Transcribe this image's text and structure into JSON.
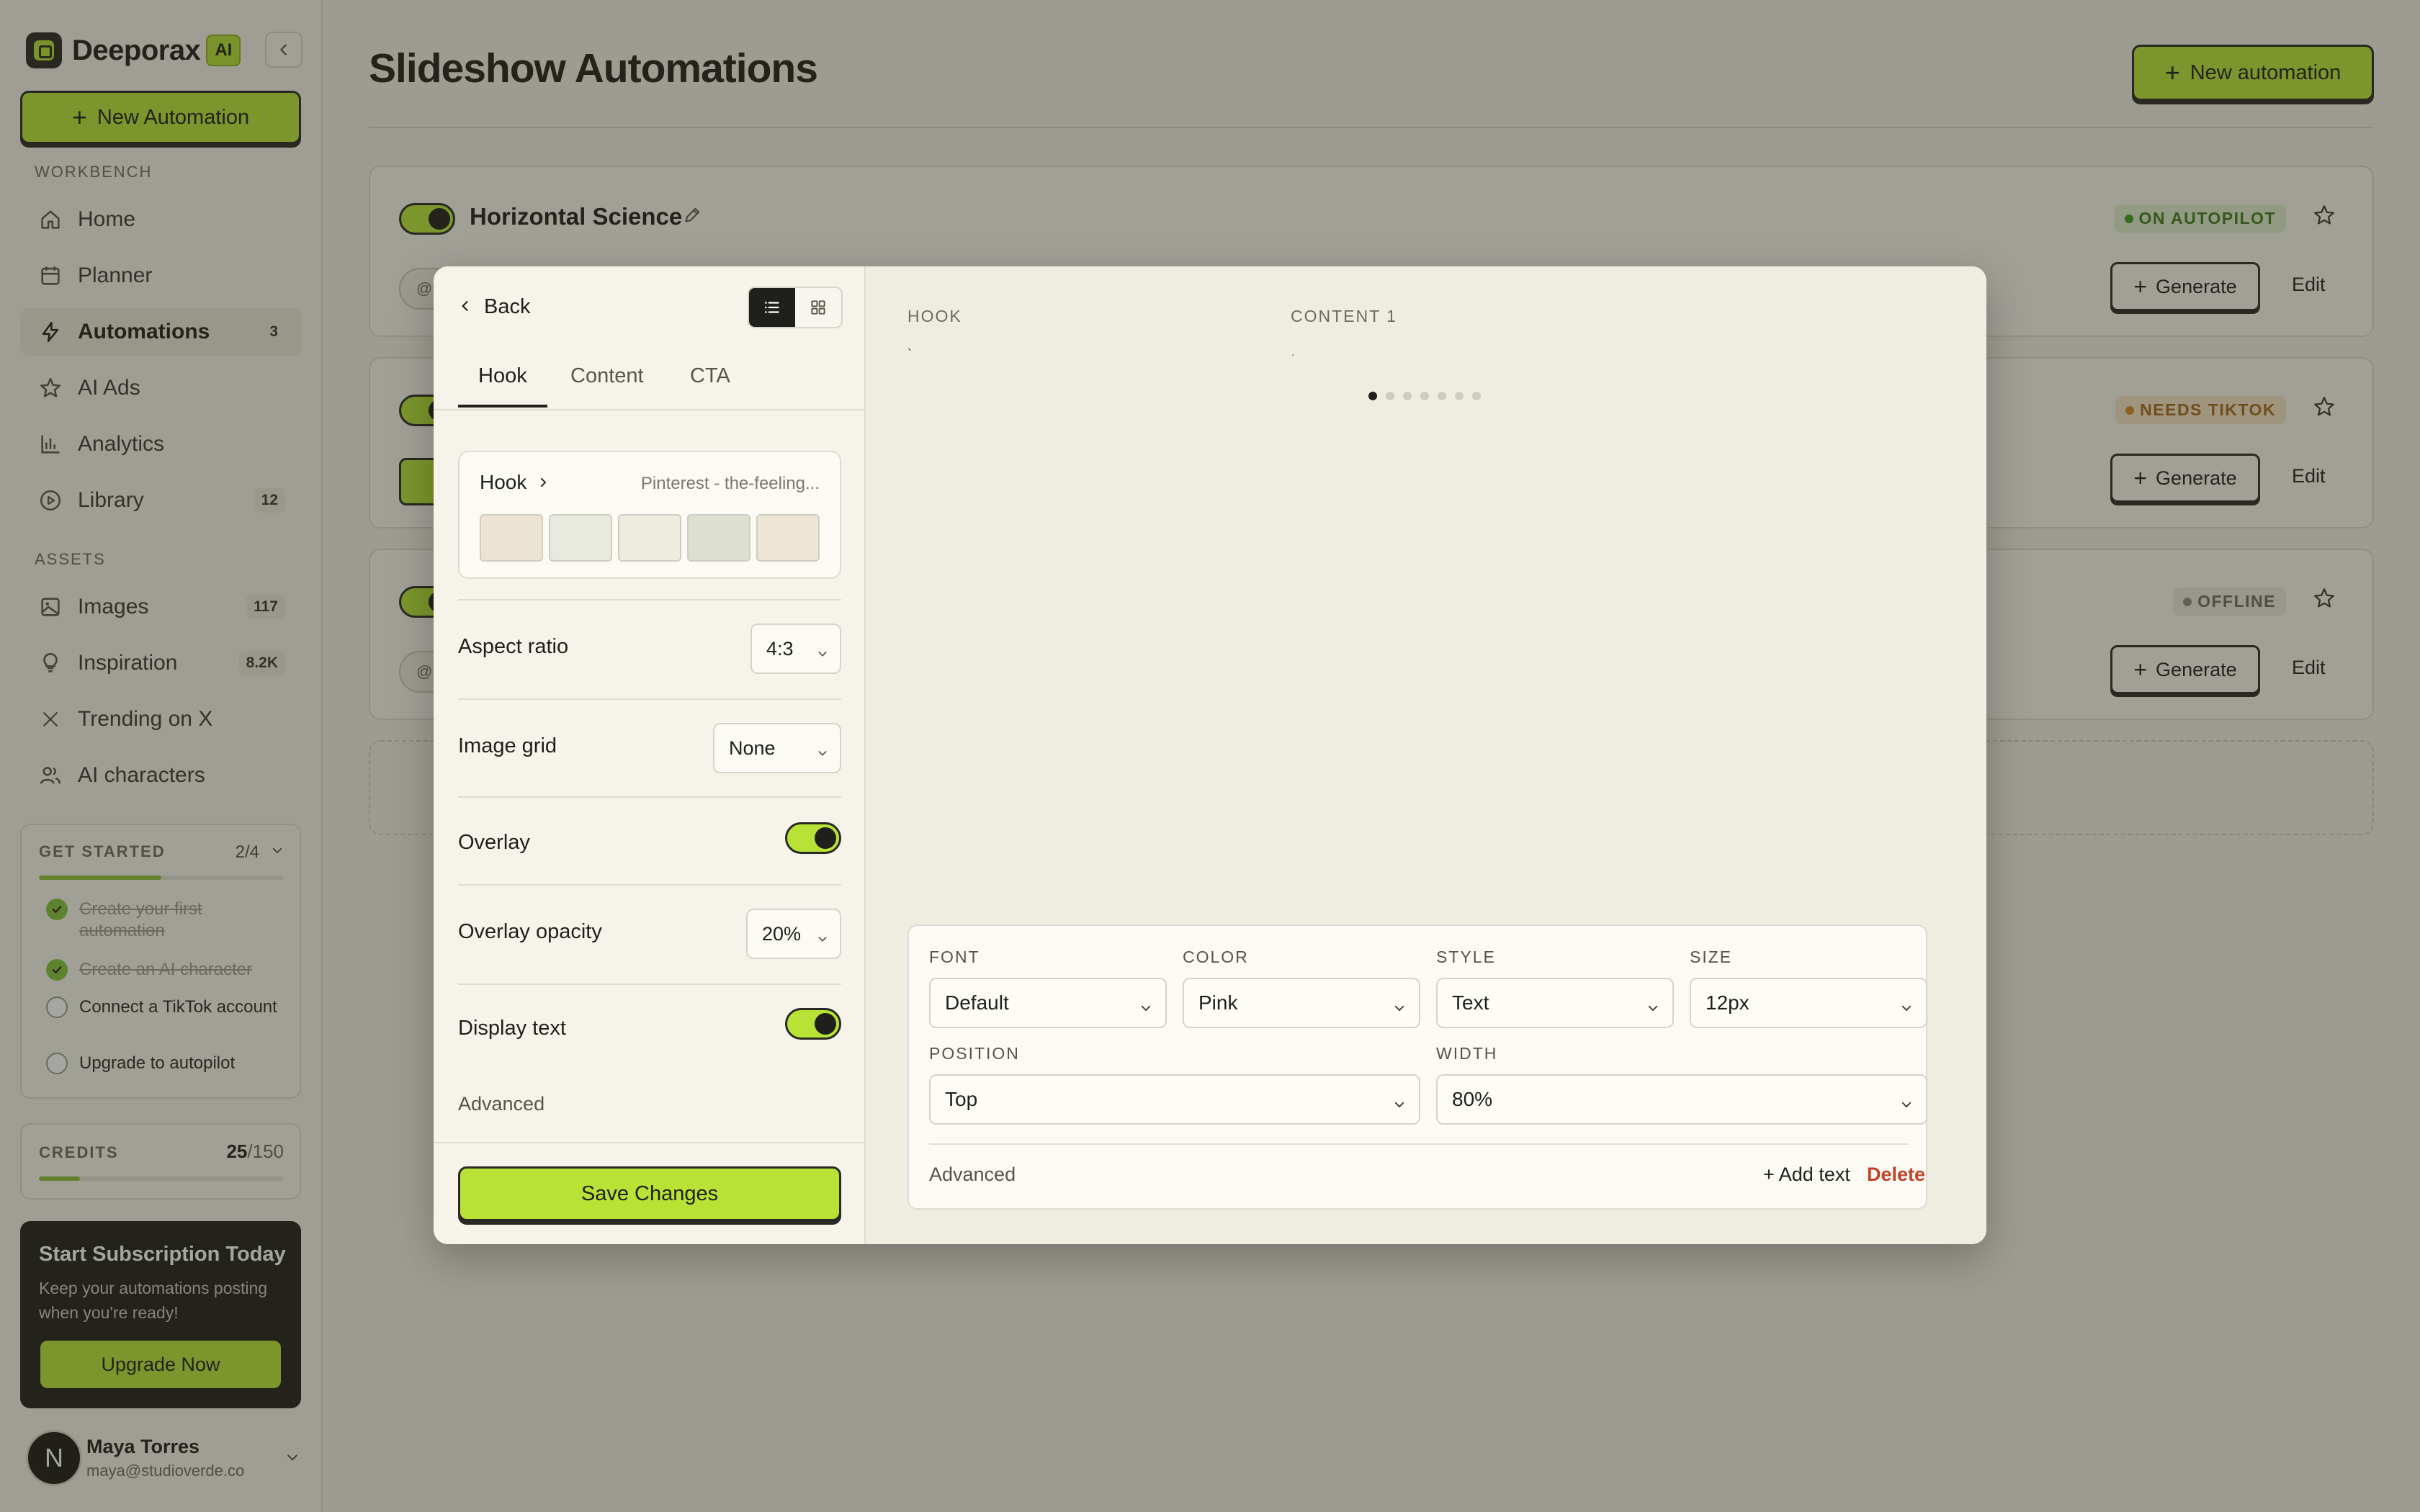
{
  "sidebar": {
    "brand": "Deeporax",
    "brand_badge": "AI",
    "new_automation": "New Automation",
    "section_workbench": "WORKBENCH",
    "section_assets": "ASSETS",
    "nav": [
      {
        "label": "Home",
        "count": ""
      },
      {
        "label": "Planner",
        "count": ""
      },
      {
        "label": "Automations",
        "count": "3"
      },
      {
        "label": "AI Ads",
        "count": ""
      },
      {
        "label": "Analytics",
        "count": ""
      },
      {
        "label": "Library",
        "count": "12"
      }
    ],
    "assets": [
      {
        "label": "Images",
        "count": "117"
      },
      {
        "label": "Inspiration",
        "count": "8.2K"
      },
      {
        "label": "Trending on X",
        "count": ""
      },
      {
        "label": "AI characters",
        "count": ""
      }
    ],
    "get_started": {
      "title": "GET STARTED",
      "progress": "2/4",
      "progress_fraction": 0.5,
      "items": [
        {
          "label": "Create your first automation",
          "done": true
        },
        {
          "label": "Create an AI character",
          "done": true
        },
        {
          "label": "Connect a TikTok account",
          "done": false
        },
        {
          "label": "Upgrade to autopilot",
          "done": false
        }
      ]
    },
    "credits": {
      "title": "CREDITS",
      "used": "25",
      "total": "/150",
      "fraction": 0.167
    },
    "subscription": {
      "title": "Start Subscription Today",
      "text": "Keep your automations posting when you're ready!",
      "button": "Upgrade Now"
    },
    "user": {
      "initial": "N",
      "name": "Maya Torres",
      "email": "maya@studioverde.co"
    }
  },
  "main": {
    "title": "Slideshow Automations",
    "new_button": "New automation",
    "cards": [
      {
        "title": "Horizontal Science",
        "status": "ON AUTOPILOT",
        "handle": "@s",
        "generate": "Generate",
        "edit": "Edit"
      },
      {
        "title": "",
        "status": "NEEDS TIKTOK",
        "handle": "",
        "generate": "Generate",
        "edit": "Edit"
      },
      {
        "title": "",
        "status": "OFFLINE",
        "handle": "@i",
        "generate": "Generate",
        "edit": "Edit"
      }
    ]
  },
  "modal": {
    "back": "Back",
    "tabs": [
      "Hook",
      "Content",
      "CTA"
    ],
    "hook_card": {
      "title": "Hook",
      "subtitle": "Pinterest - the-feeling...",
      "swatches": [
        "#ebe4d3",
        "#e8eadf",
        "#ececdf",
        "#dde0d0",
        "#ede6d6"
      ]
    },
    "aspect_ratio": {
      "label": "Aspect ratio",
      "value": "4:3"
    },
    "image_grid": {
      "label": "Image grid",
      "value": "None"
    },
    "overlay": {
      "label": "Overlay",
      "on": true
    },
    "overlay_opacity": {
      "label": "Overlay opacity",
      "value": "20%"
    },
    "display_text": {
      "label": "Display text",
      "on": true
    },
    "advanced": "Advanced",
    "save": "Save Changes",
    "preview": {
      "hook_label": "HOOK",
      "content_label": "CONTENT 1",
      "slide_count": 7,
      "active_slide": 0
    },
    "text_settings": {
      "font_label": "FONT",
      "font": "Default",
      "color_label": "COLOR",
      "color": "Pink",
      "style_label": "STYLE",
      "style": "Text",
      "size_label": "SIZE",
      "size": "12px",
      "position_label": "POSITION",
      "position": "Top",
      "width_label": "WIDTH",
      "width": "80%",
      "advanced": "Advanced",
      "add_text": "+ Add text",
      "delete": "Delete"
    }
  },
  "colors": {
    "accent": "#b8e336",
    "dark": "#1f1f1b",
    "danger": "#c0442a"
  }
}
